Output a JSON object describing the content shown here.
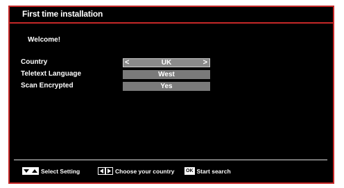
{
  "header": {
    "title": "First time installation"
  },
  "welcome": "Welcome!",
  "settings": [
    {
      "label": "Country",
      "value": "UK",
      "left_arrow": "<",
      "right_arrow": ">"
    },
    {
      "label": "Teletext Language",
      "value": "West"
    },
    {
      "label": "Scan Encrypted",
      "value": "Yes"
    }
  ],
  "footer": {
    "select_setting": "Select Setting",
    "choose_country": "Choose your country",
    "ok_key": "OK",
    "start_search": "Start search"
  },
  "colors": {
    "border": "#c62828",
    "background": "#000000",
    "field": "#7a7a7a",
    "text": "#ffffff"
  },
  "icons": [
    "down-arrow-key-icon",
    "up-arrow-key-icon",
    "left-arrow-key-icon",
    "right-arrow-key-icon",
    "ok-key-icon"
  ]
}
